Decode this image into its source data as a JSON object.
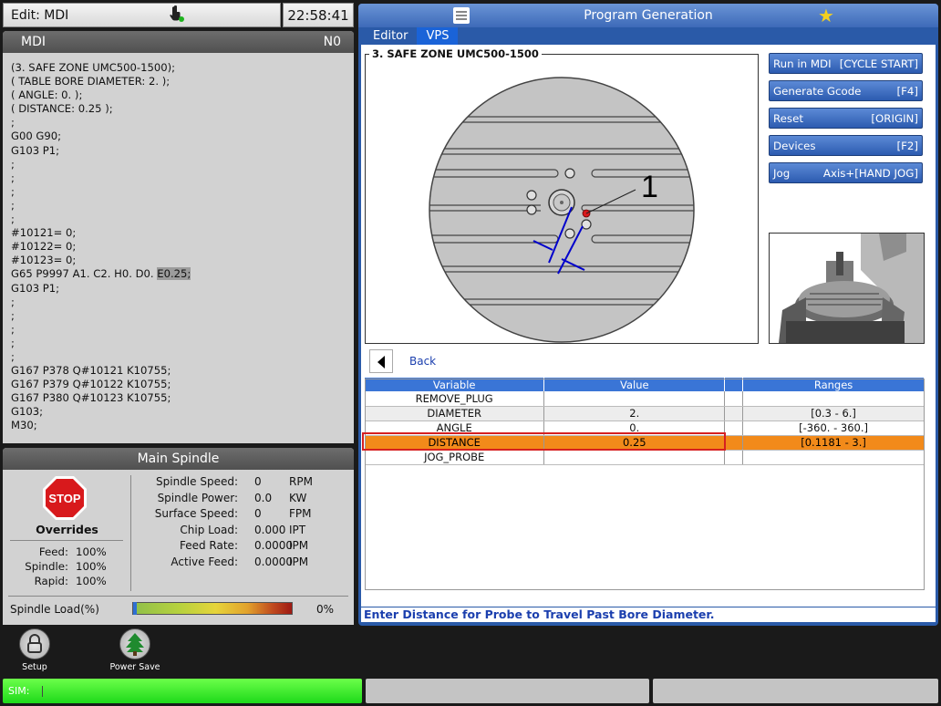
{
  "header": {
    "edit_mode": "Edit: MDI",
    "clock": "22:58:41"
  },
  "mdi": {
    "title": "MDI",
    "line_number": "N0",
    "lines": [
      "(3. SAFE ZONE UMC500-1500);",
      "( TABLE BORE DIAMETER: 2. );",
      "( ANGLE: 0. );",
      "( DISTANCE: 0.25 );",
      ";",
      "G00 G90;",
      "G103 P1;",
      ";",
      ";",
      ";",
      ";",
      ";",
      "#10121= 0;",
      "#10122= 0;",
      "#10123= 0;",
      "G65 P9997 A1. C2. H0. D0. ",
      "G103 P1;",
      ";",
      ";",
      ";",
      ";",
      ";",
      "G167 P378 Q#10121 K10755;",
      "G167 P379 Q#10122 K10755;",
      "G167 P380 Q#10123 K10755;",
      "G103;",
      "M30;"
    ],
    "highlight_text": "E0.25;",
    "highlight_line_index": 15
  },
  "spindle": {
    "title": "Main Spindle",
    "stop_label": "STOP",
    "overrides_title": "Overrides",
    "overrides": [
      {
        "label": "Feed:",
        "value": "100%"
      },
      {
        "label": "Spindle:",
        "value": "100%"
      },
      {
        "label": "Rapid:",
        "value": "100%"
      }
    ],
    "stats": [
      {
        "label": "Spindle Speed:",
        "value": "0",
        "unit": "RPM"
      },
      {
        "label": "Spindle Power:",
        "value": "0.0",
        "unit": "KW"
      },
      {
        "label": "Surface Speed:",
        "value": "0",
        "unit": "FPM"
      },
      {
        "label": "Chip Load:",
        "value": "0.000",
        "unit": "IPT"
      },
      {
        "label": "Feed Rate:",
        "value": "0.0000",
        "unit": "IPM"
      },
      {
        "label": "Active Feed:",
        "value": "0.0000",
        "unit": "IPM"
      }
    ],
    "load_label": "Spindle Load(%)",
    "load_value": "0%",
    "load_fraction": 0
  },
  "vps": {
    "title": "Program Generation",
    "tabs": [
      {
        "label": "Editor",
        "active": false
      },
      {
        "label": "VPS",
        "active": true
      }
    ],
    "figure_title": "3. SAFE ZONE UMC500-1500",
    "callout_label": "1",
    "buttons": [
      {
        "label": "Run in MDI",
        "key": "[CYCLE START]"
      },
      {
        "label": "Generate Gcode",
        "key": "[F4]"
      },
      {
        "label": "Reset",
        "key": "[ORIGIN]"
      },
      {
        "label": "Devices",
        "key": "[F2]"
      },
      {
        "label": "Jog",
        "key": "Axis+[HAND JOG]"
      }
    ],
    "back_label": "Back",
    "table": {
      "headers": [
        "Variable",
        "Value",
        "",
        "Ranges"
      ],
      "rows": [
        {
          "variable": "REMOVE_PLUG",
          "value": "",
          "ranges": ""
        },
        {
          "variable": "DIAMETER",
          "value": "2.",
          "ranges": "[0.3 - 6.]"
        },
        {
          "variable": "ANGLE",
          "value": "0.",
          "ranges": "[-360. - 360.]"
        },
        {
          "variable": "DISTANCE",
          "value": "0.25",
          "ranges": "[0.1181 - 3.]"
        },
        {
          "variable": "JOG_PROBE",
          "value": "",
          "ranges": ""
        }
      ],
      "selected_index": 3
    },
    "status_message": "Enter Distance for Probe to Travel Past Bore Diameter."
  },
  "dock": {
    "items": [
      {
        "label": "Setup",
        "icon": "lock-icon"
      },
      {
        "label": "Power Save",
        "icon": "tree-icon"
      }
    ]
  },
  "statusbar": {
    "sim_label": "SIM:"
  },
  "colors": {
    "accent_blue": "#2a5aa8",
    "selected_row": "#f28a1a",
    "sim_green": "#1ed91a",
    "stop_red": "#d8191c"
  }
}
